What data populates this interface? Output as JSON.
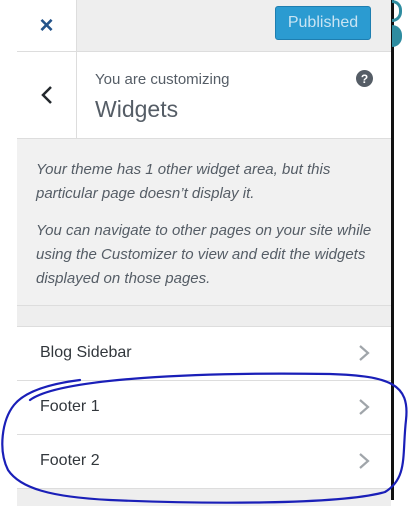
{
  "header": {
    "close_icon": "close-icon",
    "close_label": "×",
    "publish_label": "Published"
  },
  "section": {
    "customizing_label": "You are customizing",
    "title": "Widgets",
    "help_label": "?"
  },
  "description": {
    "paragraph_1": "Your theme has 1 other widget area, but this particular page doesn’t display it.",
    "paragraph_2": "You can navigate to other pages on your site while using the Customizer to view and edit the widgets displayed on those pages."
  },
  "widget_areas": [
    {
      "label": "Blog Sidebar"
    },
    {
      "label": "Footer 1"
    },
    {
      "label": "Footer 2"
    }
  ],
  "colors": {
    "publish_button": "#2b9bd1",
    "accent_blue": "#23538a",
    "annotation_stroke": "#1a1fb8"
  }
}
